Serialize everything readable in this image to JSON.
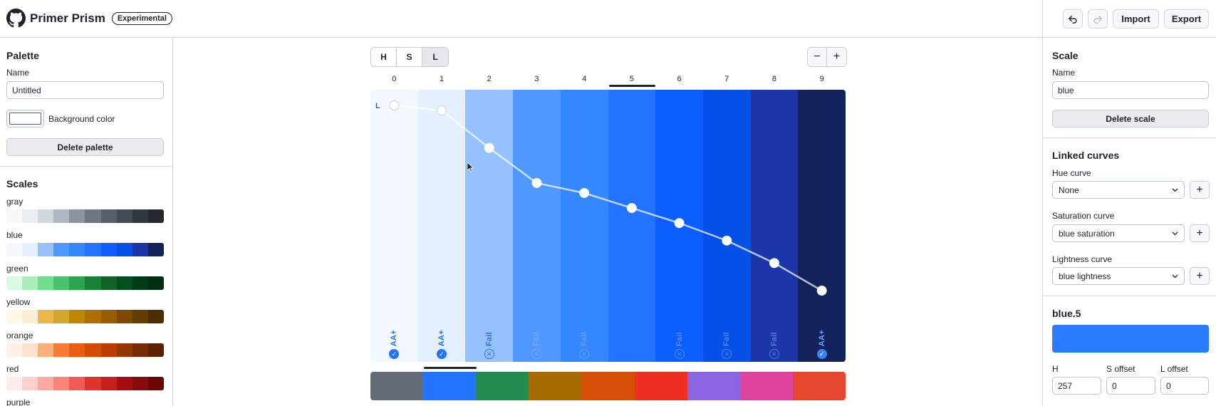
{
  "app": {
    "title": "Primer Prism",
    "badge": "Experimental"
  },
  "toolbar": {
    "undo_icon": "undo-icon",
    "redo_icon": "redo-icon",
    "import_label": "Import",
    "export_label": "Export"
  },
  "palette": {
    "section_title": "Palette",
    "name_label": "Name",
    "name_value": "Untitled",
    "background_label": "Background color",
    "delete_label": "Delete palette"
  },
  "scales": {
    "section_title": "Scales",
    "items": [
      {
        "name": "gray",
        "colors": [
          "#f6f8fa",
          "#eaeef2",
          "#d0d7de",
          "#afb8c1",
          "#8c959f",
          "#6e7781",
          "#57606a",
          "#424a53",
          "#32383f",
          "#24292f"
        ]
      },
      {
        "name": "blue",
        "colors": [
          "#f3f8ff",
          "#e5f0ff",
          "#95c2ff",
          "#4f98ff",
          "#3587ff",
          "#2273ff",
          "#0d5eff",
          "#0550e6",
          "#1a36a8",
          "#13225a"
        ]
      },
      {
        "name": "green",
        "colors": [
          "#dafbe1",
          "#aceebb",
          "#6fdd8b",
          "#4ac26b",
          "#2da44e",
          "#1a7f37",
          "#116329",
          "#044f1e",
          "#003d16",
          "#002d11"
        ]
      },
      {
        "name": "yellow",
        "colors": [
          "#fff8e5",
          "#fcefd6",
          "#ecb64a",
          "#d4a72c",
          "#bf8700",
          "#b06d00",
          "#9a5c00",
          "#7d4900",
          "#633c01",
          "#4d2d00"
        ]
      },
      {
        "name": "orange",
        "colors": [
          "#fff1e5",
          "#ffe4cc",
          "#ffb07a",
          "#f87b35",
          "#ea5c12",
          "#d44b06",
          "#bc3c02",
          "#953800",
          "#762c00",
          "#5c2200"
        ]
      },
      {
        "name": "red",
        "colors": [
          "#ffebe9",
          "#ffcfcb",
          "#ffa9a1",
          "#ff8279",
          "#f45a54",
          "#e0332c",
          "#c81e1e",
          "#a40e0e",
          "#8a0b0b",
          "#6a0606"
        ]
      },
      {
        "name": "purple",
        "colors": [
          "#fbefff",
          "#ecd8ff",
          "#d8b9ff",
          "#c297ff",
          "#a475f9",
          "#8250df",
          "#6639ba",
          "#512a97",
          "#3e1f79",
          "#2e1461"
        ]
      }
    ]
  },
  "center": {
    "modes": [
      {
        "label": "H",
        "active": false
      },
      {
        "label": "S",
        "active": false
      },
      {
        "label": "L",
        "active": true
      }
    ],
    "zoom_out": "−",
    "zoom_in": "+",
    "curve_label": "L",
    "active_index": 5,
    "columns": [
      {
        "index": "0",
        "color": "#f3f8ff",
        "lightness": 97,
        "contrast": "AA+",
        "pass": true
      },
      {
        "index": "1",
        "color": "#e5f0ff",
        "lightness": 95,
        "contrast": "AA+",
        "pass": true
      },
      {
        "index": "2",
        "color": "#95c2ff",
        "lightness": 80,
        "contrast": "Fail",
        "pass": false
      },
      {
        "index": "3",
        "color": "#4f98ff",
        "lightness": 66,
        "contrast": "Fail",
        "pass": false
      },
      {
        "index": "4",
        "color": "#3587ff",
        "lightness": 62,
        "contrast": "Fail",
        "pass": false
      },
      {
        "index": "5",
        "color": "#2273ff",
        "lightness": 56,
        "contrast": "",
        "pass": false
      },
      {
        "index": "6",
        "color": "#0d5eff",
        "lightness": 50,
        "contrast": "Fail",
        "pass": false
      },
      {
        "index": "7",
        "color": "#0550e6",
        "lightness": 43,
        "contrast": "Fail",
        "pass": false
      },
      {
        "index": "8",
        "color": "#1a36a8",
        "lightness": 34,
        "contrast": "Fail",
        "pass": false
      },
      {
        "index": "9",
        "color": "#13225a",
        "lightness": 23,
        "contrast": "AA+",
        "pass": true
      }
    ],
    "palette_strip": [
      "#636c76",
      "#2273ff",
      "#228c4e",
      "#a86b02",
      "#d54f06",
      "#ef2e22",
      "#8b64e0",
      "#e0429f",
      "#e5472f"
    ]
  },
  "scale": {
    "section_title": "Scale",
    "name_label": "Name",
    "name_value": "blue",
    "delete_label": "Delete scale"
  },
  "linked_curves": {
    "section_title": "Linked curves",
    "hue_label": "Hue curve",
    "hue_value": "None",
    "saturation_label": "Saturation curve",
    "saturation_value": "blue saturation",
    "lightness_label": "Lightness curve",
    "lightness_value": "blue lightness"
  },
  "selected_color": {
    "title": "blue.5",
    "swatch": "#2a7bff",
    "h_label": "H",
    "h_value": "257",
    "s_label": "S offset",
    "s_value": "0",
    "l_label": "L offset",
    "l_value": "0"
  }
}
